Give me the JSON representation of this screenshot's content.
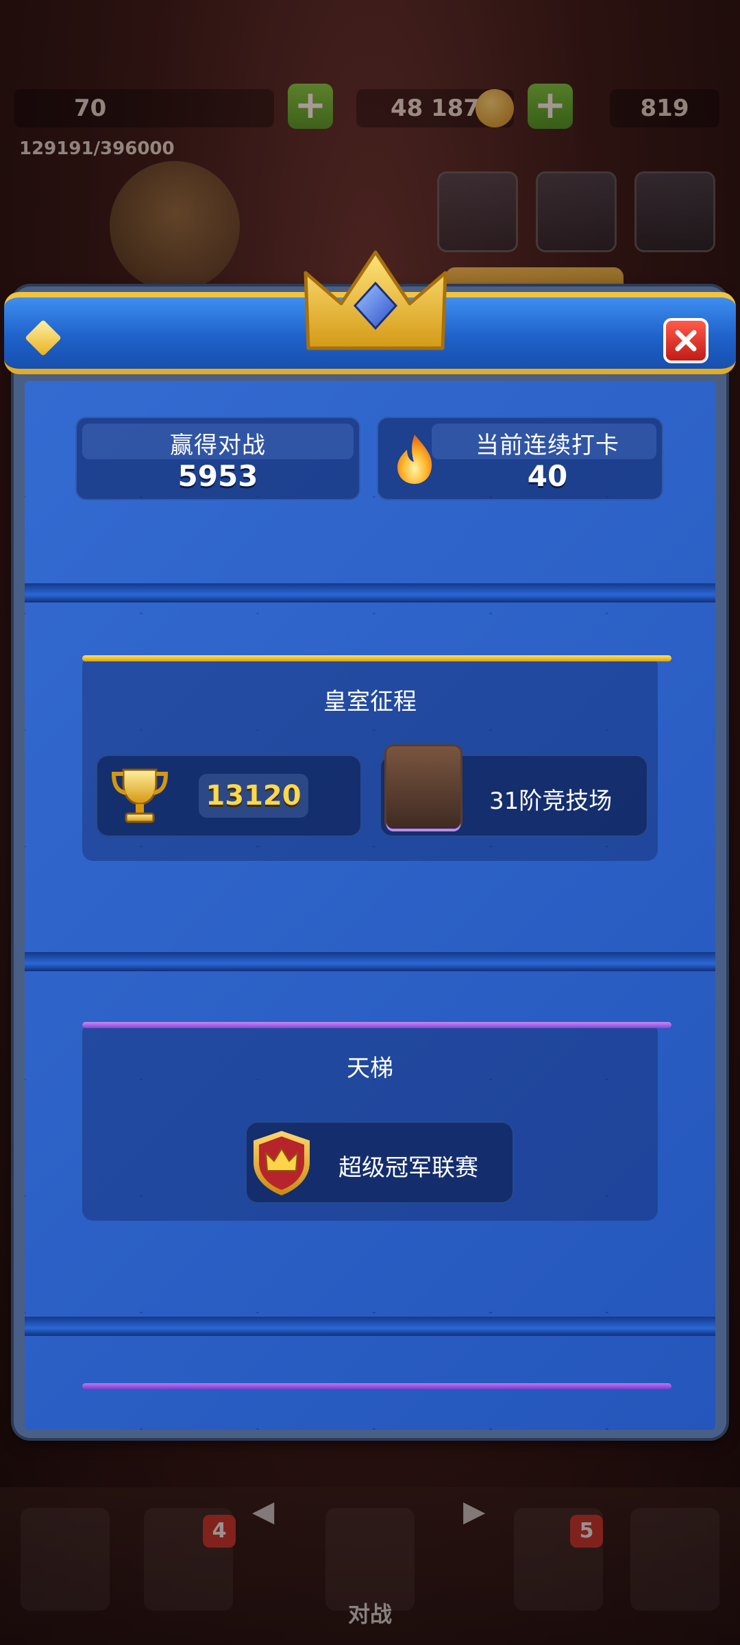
{
  "hud": {
    "level_icon_text": "70",
    "xp_progress": "129191/396000",
    "gold": "48 187",
    "gems": "819"
  },
  "stats": {
    "wins_label": "赢得对战",
    "wins_value": "5953",
    "streak_label": "当前连续打卡",
    "streak_value": "40"
  },
  "royal_journey": {
    "title": "皇室征程",
    "trophies": "13120",
    "arena": "31阶竞技场"
  },
  "ladder": {
    "title": "天梯",
    "league": "超级冠军联赛"
  },
  "nav": {
    "cards_badge": "4",
    "clan_badge": "5",
    "battle_label": "对战"
  },
  "colors": {
    "gold": "#f2c33c",
    "header_blue": "#1f62c9",
    "body_blue": "#2a5fc4",
    "royal_line": "#f1c21f",
    "ladder_line": "#a55ee6",
    "close_red": "#d1342b"
  },
  "icons": {
    "crown": "crown-gem-icon",
    "close": "close-icon",
    "flame": "flame-icon",
    "trophy": "trophy-icon",
    "arena": "arena-image",
    "league": "league-badge-icon"
  }
}
